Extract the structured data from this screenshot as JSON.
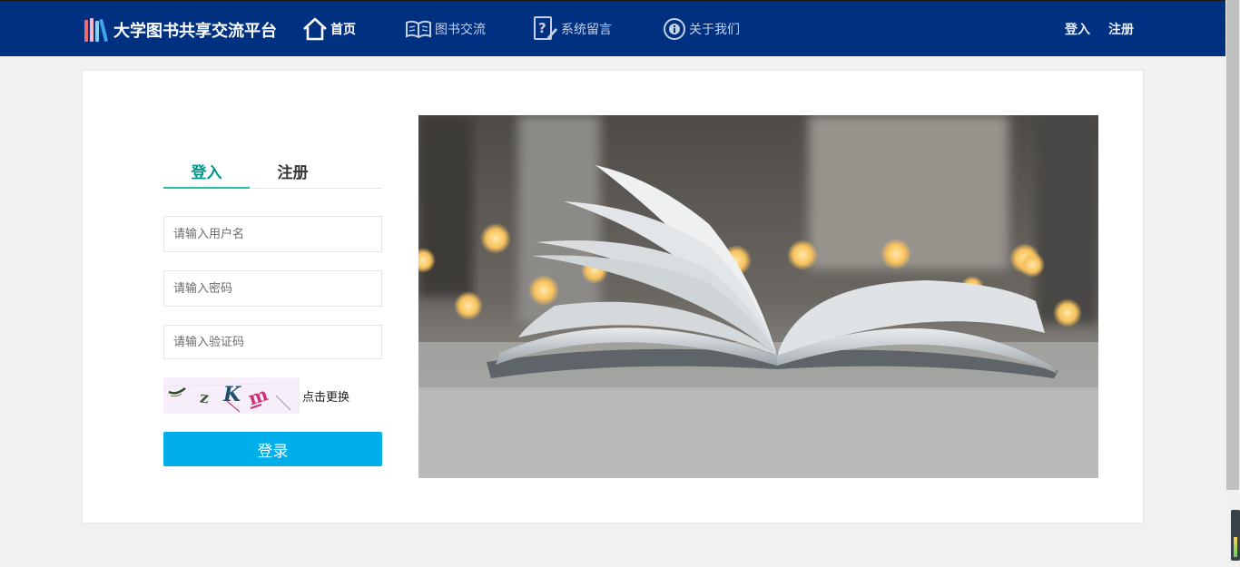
{
  "header": {
    "brand": "大学图书共享交流平台",
    "nav": [
      {
        "label": "首页",
        "icon": "home-icon"
      },
      {
        "label": "图书交流",
        "icon": "book-icon"
      },
      {
        "label": "系统留言",
        "icon": "message-icon"
      },
      {
        "label": "关于我们",
        "icon": "info-icon"
      }
    ],
    "login": "登入",
    "register": "注册"
  },
  "form": {
    "tabs": [
      {
        "label": "登入",
        "active": true
      },
      {
        "label": "注册",
        "active": false
      }
    ],
    "username_placeholder": "请输入用户名",
    "password_placeholder": "请输入密码",
    "captcha_placeholder": "请输入验证码",
    "captcha_text": "zKm",
    "captcha_refresh": "点击更换",
    "submit": "登录"
  },
  "colors": {
    "nav_bg": "#003180",
    "accent_tab": "#009688",
    "button": "#00aeea"
  }
}
